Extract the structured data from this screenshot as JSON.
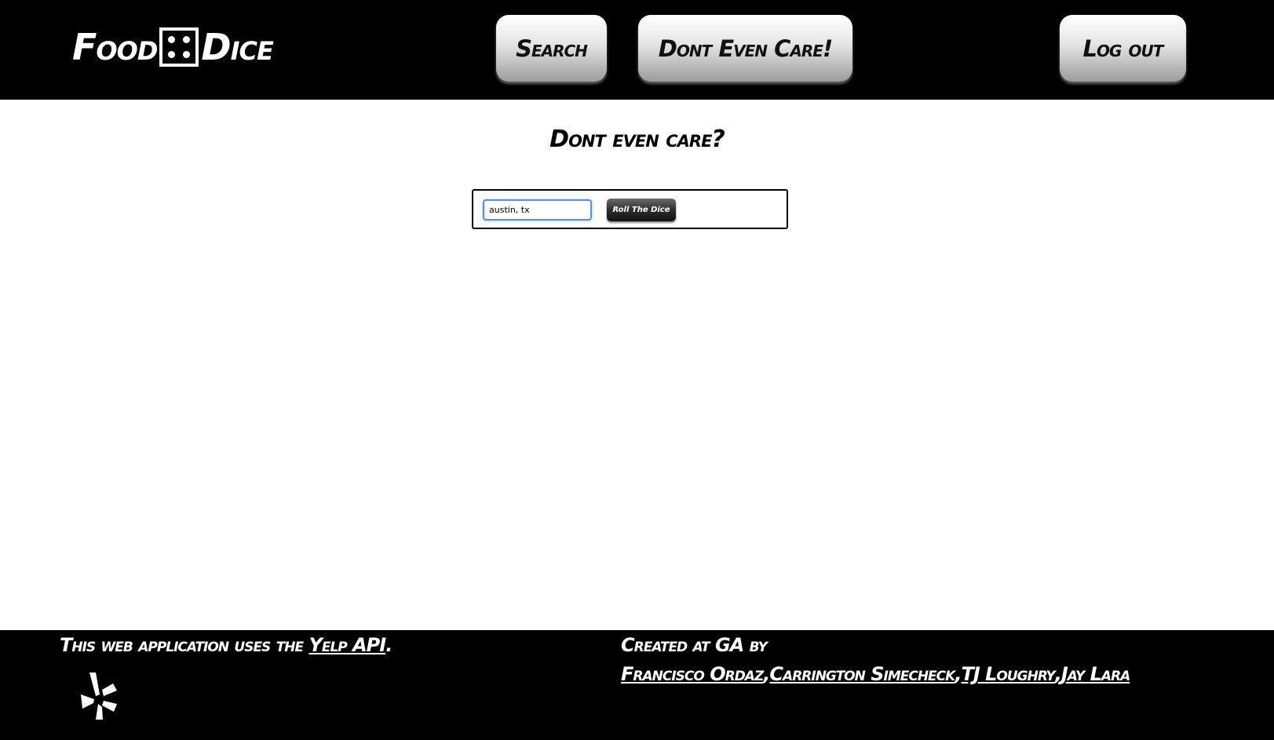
{
  "header": {
    "logo": {
      "left_text": "Food",
      "right_text": "Dice",
      "die_icon": "die-four-icon"
    },
    "nav": {
      "search_label": "Search",
      "dont_care_label": "Dont Even Care!",
      "logout_label": "Log out"
    }
  },
  "main": {
    "title": "Dont even care?",
    "form": {
      "location_value": "austin, tx",
      "submit_label": "Roll The Dice"
    }
  },
  "footer": {
    "yelp_prefix": "This web application uses the ",
    "yelp_link": "Yelp API",
    "yelp_suffix": ".",
    "yelp_icon": "yelp-burst-icon",
    "credits_prefix": "Created at GA by",
    "authors": [
      "Francisco Ordaz",
      "Carrington Simecheck",
      "TJ Loughry",
      "Jay Lara"
    ],
    "author_separator": ","
  },
  "colors": {
    "header_bg": "#000000",
    "footer_bg": "#000000",
    "page_bg": "#ffffff",
    "input_focus": "#4d90fe"
  }
}
